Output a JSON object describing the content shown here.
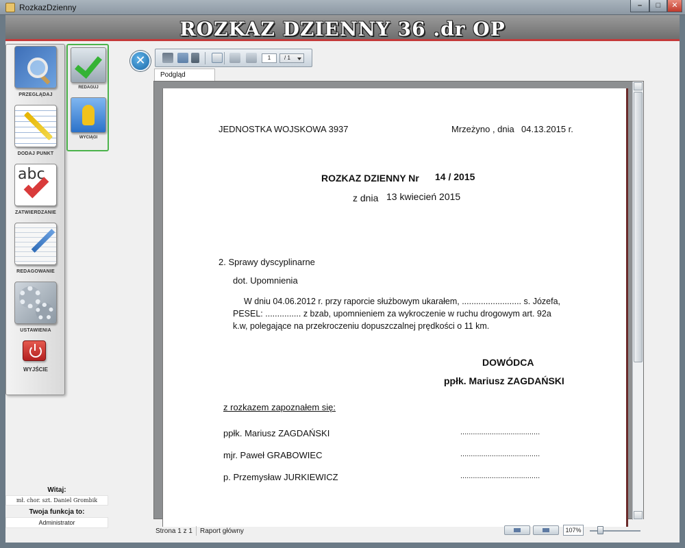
{
  "window": {
    "title": "RozkazDzienny",
    "minimize": "–",
    "maximize": "□",
    "close": "✕"
  },
  "header": {
    "title": "ROZKAZ DZIENNY 36 .dr OP"
  },
  "sidebar": {
    "items": [
      {
        "label": "PRZEGLĄDAJ",
        "icon": "magnifier-book-icon"
      },
      {
        "label": "DODAJ PUNKT",
        "icon": "notepad-pencil-icon"
      },
      {
        "label": "ZATWIERDZANIE",
        "icon": "abc-check-icon"
      },
      {
        "label": "REDAGOWANIE",
        "icon": "edit-document-icon"
      },
      {
        "label": "USTAWIENIA",
        "icon": "gears-icon"
      }
    ],
    "exit_label": "WYJŚCIE"
  },
  "subpanel": {
    "items": [
      {
        "label": "REDAGUJ",
        "icon": "folder-check-icon"
      },
      {
        "label": "WYCIĄGI",
        "icon": "runner-icon"
      }
    ]
  },
  "user": {
    "welcome_label": "Witaj:",
    "name": "mł. chor. szt. Daniel Grombik",
    "function_label": "Twoja funkcja to:",
    "function": "Administrator"
  },
  "toolbar": {
    "close_glyph": "✕",
    "current_page": "1",
    "total_pages": "/ 1"
  },
  "tabs": {
    "preview": "Podgląd"
  },
  "document": {
    "unit": "JEDNOSTKA WOJSKOWA 3937",
    "place_date": "Mrzeżyno , dnia",
    "date": "04.13.2015 r.",
    "order_title": "ROZKAZ DZIENNY Nr",
    "order_number": "14 / 2015",
    "order_date_prefix": "z dnia",
    "order_date": "13 kwiecień 2015",
    "section": "2. Sprawy dyscyplinarne",
    "subject": "dot. Upomnienia",
    "body_line1": "W dniu 04.06.2012 r. przy raporcie służbowym ukarałem, ......................... s. Józefa,",
    "body_line2": "PESEL: ............... z bzab, upomnieniem za wykroczenie w ruchu drogowym art. 92a",
    "body_line3": "k.w, polegające na przekroczeniu dopuszczalnej prędkości o 11 km.",
    "commander_title": "DOWÓDCA",
    "commander_name": "ppłk. Mariusz ZAGDAŃSKI",
    "acknowledged": "z rozkazem zapoznałem się:",
    "signatures": [
      {
        "name": "ppłk. Mariusz ZAGDAŃSKI",
        "line": "......................................"
      },
      {
        "name": "mjr. Paweł GRABOWIEC",
        "line": "......................................"
      },
      {
        "name": "p. Przemysław JURKIEWICZ",
        "line": "......................................"
      }
    ]
  },
  "statusbar": {
    "page_info": "Strona 1 z 1",
    "report": "Raport główny",
    "zoom": "107%",
    "zoom_fraction": 0.2
  },
  "colors": {
    "accent_red": "#c43a3a",
    "active_green": "#4bb34b"
  }
}
